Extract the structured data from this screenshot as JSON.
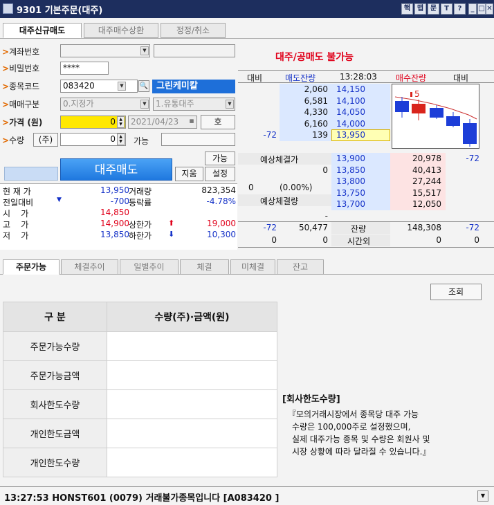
{
  "window": {
    "code": "9301",
    "title": "기본주문(대주)",
    "tb_icons": [
      "핵",
      "맵",
      "문",
      "T",
      "?"
    ]
  },
  "tabs_top": [
    "대주신규매도",
    "대주매수상환",
    "정정/취소"
  ],
  "form": {
    "account_label": "계좌번호",
    "password_label": "비밀번호",
    "password_value": "****",
    "stock_label": "종목코드",
    "stock_code": "083420",
    "stock_name": "그린케미칼",
    "trade_type_label": "매매구분",
    "trade_type_value": "0.지정가",
    "loan_type_value": "1.유통대주",
    "price_label": "가격 (원)",
    "price_value": "0",
    "date_value": "2021/04/23",
    "quote_button": "호",
    "qty_label": "수량",
    "qty_unit_button": "(주)",
    "qty_value": "0",
    "avail_label": "가능",
    "avail_button": "가능",
    "sell_button": "대주매도",
    "clear_button": "지움",
    "settings_button": "설정"
  },
  "status_banner": "대주/공매도 불가능",
  "price_info": {
    "rows": [
      {
        "label": "현 재 가",
        "value": "13,950",
        "label2": "거래량",
        "value2": "823,354"
      },
      {
        "label": "전일대비",
        "value": "-700",
        "label2": "등락률",
        "value2": "-4.78%"
      },
      {
        "label": "시    가",
        "value": "14,850",
        "label2": "",
        "value2": ""
      },
      {
        "label": "고    가",
        "value": "14,900",
        "label2": "상한가",
        "value2": "19,000"
      },
      {
        "label": "저    가",
        "value": "13,850",
        "label2": "하한가",
        "value2": "10,300"
      }
    ]
  },
  "quote": {
    "headers": {
      "diff": "대비",
      "ask_rem": "매도잔량",
      "time": "13:28:03",
      "bid_rem": "매수잔량",
      "diff2": "대비"
    },
    "asks": [
      {
        "diff": "",
        "rem": "2,060",
        "price": "14,150"
      },
      {
        "diff": "",
        "rem": "6,581",
        "price": "14,100"
      },
      {
        "diff": "",
        "rem": "4,330",
        "price": "14,050"
      },
      {
        "diff": "",
        "rem": "6,160",
        "price": "14,000"
      },
      {
        "diff": "-72",
        "rem": "139",
        "price": "13,950"
      }
    ],
    "bids": [
      {
        "price": "13,900",
        "rem": "20,978",
        "diff": "-72"
      },
      {
        "price": "13,850",
        "rem": "40,413",
        "diff": ""
      },
      {
        "price": "13,800",
        "rem": "27,244",
        "diff": ""
      },
      {
        "price": "13,750",
        "rem": "15,517",
        "diff": ""
      },
      {
        "price": "13,700",
        "rem": "12,050",
        "diff": ""
      }
    ],
    "expected_label": "예상체결가",
    "expected_value": "0",
    "expected_qty": "0",
    "expected_rate": "(0.00%)",
    "expected_vol_label": "예상체결량",
    "expected_vol_value": "-",
    "total_ask_diff": "-72",
    "total_ask": "50,477",
    "total_label": "잔량",
    "total_bid": "148,308",
    "total_bid_diff": "-72",
    "after_ask_diff": "0",
    "after_ask": "0",
    "after_label": "시간외",
    "after_bid": "0",
    "after_bid_diff": "0",
    "chart_marker": "5"
  },
  "tabs_bottom": [
    "주문가능",
    "체결추이",
    "일별추이",
    "체결",
    "미체결",
    "잔고"
  ],
  "query_button": "조회",
  "table": {
    "header_left": "구  분",
    "header_right": "수량(주)·금액(원)",
    "rows": [
      "주문가능수량",
      "주문가능금액",
      "회사한도수량",
      "개인한도금액",
      "개인한도수량"
    ]
  },
  "note": {
    "title": "[회사한도수량]",
    "line1": "『모의거래시장에서 종목당 대주 가능",
    "line2": "수량은 100,000주로 설정했으며,",
    "line3": "실제 대주가능 종목 및 수량은 회원사 및",
    "line4": "시장 상황에 따라 달라질 수 있습니다.』"
  },
  "statusbar": "13:27:53 HONST601 (0079) 거래불가종목입니다 [A083420 ]",
  "colors": {
    "title_bg": "#1d2e5e",
    "sell_blue": "#2a86ea",
    "ask_bg": "#dbe8ff",
    "bid_bg": "#fde3e3",
    "highlight": "#ffffb4"
  }
}
